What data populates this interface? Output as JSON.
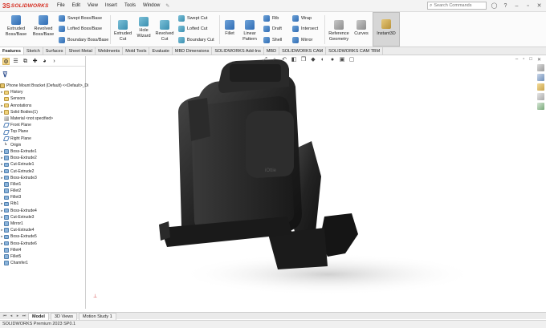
{
  "app": {
    "logo_mark": "3S",
    "logo_text": "SOLIDWORKS",
    "menu": [
      "File",
      "Edit",
      "View",
      "Insert",
      "Tools",
      "Window"
    ],
    "search_placeholder": "Search Commands"
  },
  "ribbon": {
    "extruded_boss": "Extruded Boss/Base",
    "revolved_boss": "Revolved Boss/Base",
    "swept_boss": "Swept Boss/Base",
    "lofted_boss": "Lofted Boss/Base",
    "boundary_boss": "Boundary Boss/Base",
    "extruded_cut": "Extruded Cut",
    "hole_wizard": "Hole Wizard",
    "revolved_cut": "Revolved Cut",
    "swept_cut": "Swept Cut",
    "lofted_cut": "Lofted Cut",
    "boundary_cut": "Boundary Cut",
    "fillet": "Fillet",
    "linear_pattern": "Linear Pattern",
    "rib": "Rib",
    "draft": "Draft",
    "shell": "Shell",
    "wrap": "Wrap",
    "intersect": "Intersect",
    "mirror": "Mirror",
    "reference_geometry": "Reference Geometry",
    "curves": "Curves",
    "instant3d": "Instant3D"
  },
  "tabs": [
    "Features",
    "Sketch",
    "Surfaces",
    "Sheet Metal",
    "Weldments",
    "Mold Tools",
    "Evaluate",
    "MBD Dimensions",
    "SOLIDWORKS Add-Ins",
    "MBD",
    "SOLIDWORKS CAM",
    "SOLIDWORKS CAM TBM"
  ],
  "active_tab": "Features",
  "tree": [
    {
      "label": "Phone Mount Bracket  (Default) <<Default>_Di",
      "icon": "part",
      "arrow": ""
    },
    {
      "label": "History",
      "icon": "folder",
      "arrow": "▸"
    },
    {
      "label": "Sensors",
      "icon": "folder",
      "arrow": ""
    },
    {
      "label": "Annotations",
      "icon": "folder",
      "arrow": "▸"
    },
    {
      "label": "Solid Bodies(1)",
      "icon": "folder",
      "arrow": "▸"
    },
    {
      "label": "Material <not specified>",
      "icon": "mat",
      "arrow": ""
    },
    {
      "label": "Front Plane",
      "icon": "plane",
      "arrow": ""
    },
    {
      "label": "Top Plane",
      "icon": "plane",
      "arrow": ""
    },
    {
      "label": "Right Plane",
      "icon": "plane",
      "arrow": ""
    },
    {
      "label": "Origin",
      "icon": "origin",
      "arrow": ""
    },
    {
      "label": "Boss-Extrude1",
      "icon": "feat",
      "arrow": "▸"
    },
    {
      "label": "Boss-Extrude2",
      "icon": "feat",
      "arrow": "▸"
    },
    {
      "label": "Cut-Extrude1",
      "icon": "feat",
      "arrow": "▸"
    },
    {
      "label": "Cut-Extrude2",
      "icon": "feat",
      "arrow": "▸"
    },
    {
      "label": "Boss-Extrude3",
      "icon": "feat",
      "arrow": "▸"
    },
    {
      "label": "Fillet1",
      "icon": "feat",
      "arrow": ""
    },
    {
      "label": "Fillet2",
      "icon": "feat",
      "arrow": ""
    },
    {
      "label": "Fillet3",
      "icon": "feat",
      "arrow": ""
    },
    {
      "label": "Rib1",
      "icon": "feat",
      "arrow": "▸"
    },
    {
      "label": "Boss-Extrude4",
      "icon": "feat",
      "arrow": "▸"
    },
    {
      "label": "Cut-Extrude3",
      "icon": "feat",
      "arrow": "▸"
    },
    {
      "label": "Mirror1",
      "icon": "feat",
      "arrow": ""
    },
    {
      "label": "Cut-Extrude4",
      "icon": "feat",
      "arrow": "▸"
    },
    {
      "label": "Boss-Extrude5",
      "icon": "feat",
      "arrow": "▸"
    },
    {
      "label": "Boss-Extrude6",
      "icon": "feat",
      "arrow": "▸"
    },
    {
      "label": "Fillet4",
      "icon": "feat",
      "arrow": ""
    },
    {
      "label": "Fillet5",
      "icon": "feat",
      "arrow": ""
    },
    {
      "label": "Chamfer1",
      "icon": "feat",
      "arrow": ""
    }
  ],
  "bottom_tabs": [
    "Model",
    "3D Views",
    "Motion Study 1"
  ],
  "active_bottom_tab": "Model",
  "status": "SOLIDWORKS Premium 2023 SP0.1",
  "colors": {
    "brand": "#d52b1e",
    "model_dark": "#1c1c1c"
  }
}
